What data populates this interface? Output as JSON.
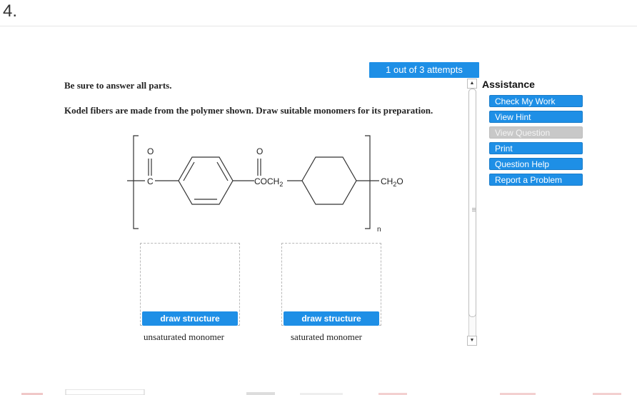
{
  "question": {
    "number": "4."
  },
  "attempts": {
    "label": "1 out of 3 attempts"
  },
  "content": {
    "instruction": "Be sure to answer all parts.",
    "prompt": "Kodel fibers are made from the polymer shown. Draw suitable monomers for its preparation."
  },
  "structure": {
    "carbonyl_o1": "O",
    "carbonyl_c1": "C",
    "carbonyl_o2": "O",
    "ester_group": "COCH",
    "ester_sub": "2",
    "end_group": "CH",
    "end_sub": "2",
    "end_o": "O",
    "repeat": "n"
  },
  "assistance": {
    "title": "Assistance",
    "buttons": [
      {
        "label": "Check My Work",
        "enabled": true
      },
      {
        "label": "View Hint",
        "enabled": true
      },
      {
        "label": "View Question",
        "enabled": false
      },
      {
        "label": "Print",
        "enabled": true
      },
      {
        "label": "Question Help",
        "enabled": true
      },
      {
        "label": "Report a Problem",
        "enabled": true
      }
    ]
  },
  "answers": [
    {
      "button": "draw structure",
      "caption": "unsaturated monomer"
    },
    {
      "button": "draw structure",
      "caption": "saturated monomer"
    }
  ],
  "scrollbar": {
    "up_glyph": "▲",
    "down_glyph": "▼"
  },
  "colors": {
    "accent": "#1e8fe6",
    "disabled": "#c8c8c8"
  }
}
